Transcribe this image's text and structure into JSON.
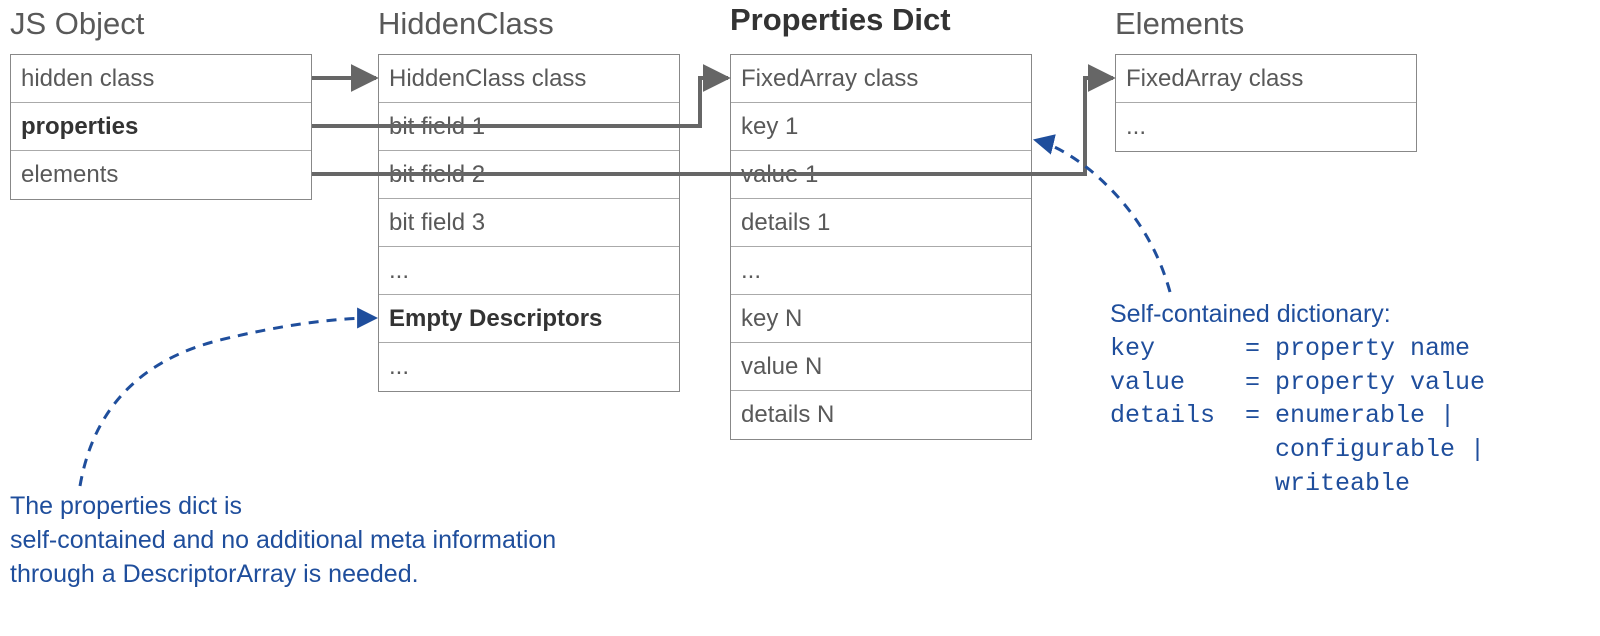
{
  "titles": {
    "jsobject": "JS Object",
    "hiddenclass": "HiddenClass",
    "propsdict": "Properties Dict",
    "elements": "Elements"
  },
  "jsobject": {
    "r0": "hidden class",
    "r1": "properties",
    "r2": "elements"
  },
  "hiddenclass": {
    "r0": "HiddenClass class",
    "r1": "bit field 1",
    "r2": "bit field 2",
    "r3": "bit field 3",
    "r4": "...",
    "r5": "Empty Descriptors",
    "r6": "..."
  },
  "propsdict": {
    "r0": "FixedArray class",
    "r1": "key 1",
    "r2": "value 1",
    "r3": "details 1",
    "r4": "...",
    "r5": "key N",
    "r6": "value N",
    "r7": "details N"
  },
  "elements": {
    "r0": "FixedArray class",
    "r1": "..."
  },
  "annotations": {
    "left_l1": "The properties dict is",
    "left_l2": "self-contained and no additional meta information",
    "left_l3": "through a DescriptorArray is needed.",
    "right_l1": "Self-contained dictionary:",
    "right_l2a": "key",
    "right_l2b": "= property name",
    "right_l3a": "value",
    "right_l3b": "= property value",
    "right_l4a": "details",
    "right_l4b": "= enumerable   |",
    "right_l5": "configurable |",
    "right_l6": "writeable"
  }
}
